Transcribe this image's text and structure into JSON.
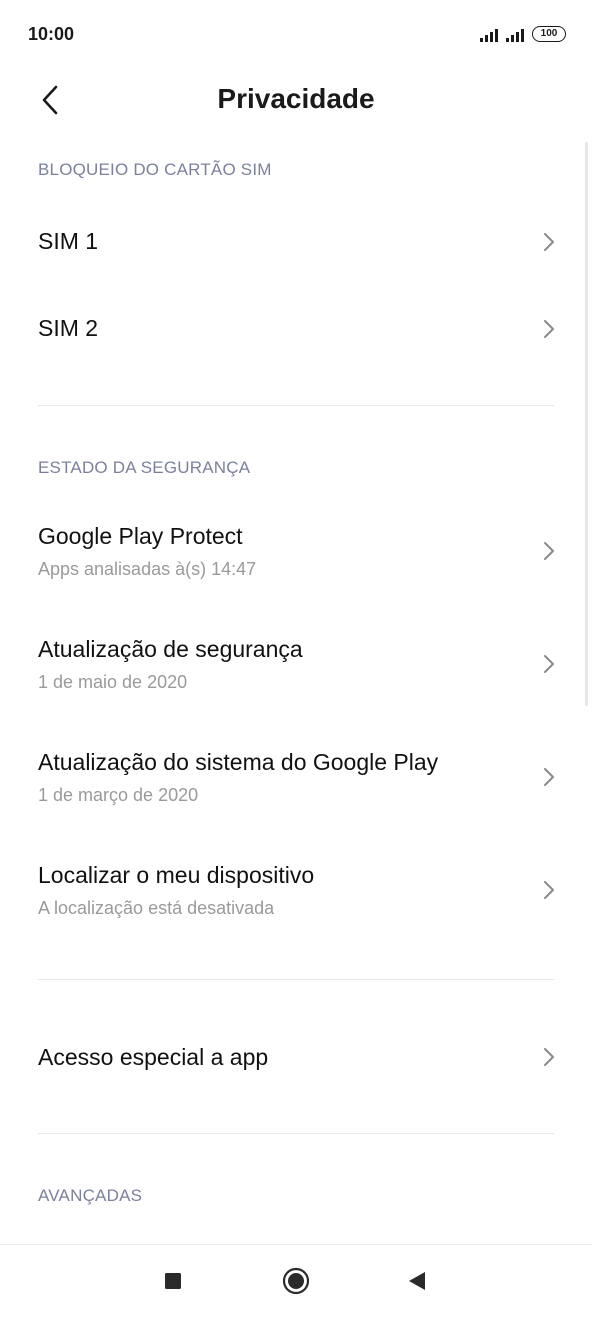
{
  "status_bar": {
    "time": "10:00",
    "battery": "100"
  },
  "header": {
    "title": "Privacidade"
  },
  "sections": {
    "sim_lock": {
      "label": "BLOQUEIO DO CARTÃO SIM",
      "items": [
        {
          "title": "SIM 1"
        },
        {
          "title": "SIM 2"
        }
      ]
    },
    "security_status": {
      "label": "ESTADO DA SEGURANÇA",
      "items": [
        {
          "title": "Google Play Protect",
          "subtitle": "Apps analisadas à(s) 14:47"
        },
        {
          "title": "Atualização de segurança",
          "subtitle": "1 de maio de 2020"
        },
        {
          "title": "Atualização do sistema do Google Play",
          "subtitle": "1 de março de 2020"
        },
        {
          "title": "Localizar o meu dispositivo",
          "subtitle": "A localização está desativada"
        }
      ]
    },
    "special": {
      "items": [
        {
          "title": "Acesso especial a app"
        }
      ]
    },
    "advanced": {
      "label": "AVANÇADAS"
    }
  },
  "icons": {
    "back": "back-arrow-icon",
    "chevron": "chevron-right-icon",
    "nav_recents": "square-icon",
    "nav_home": "circle-icon",
    "nav_back": "triangle-back-icon"
  },
  "colors": {
    "section_label": "#7b819b",
    "subtitle": "#9a9a9a",
    "chevron": "#8a8a8a"
  }
}
